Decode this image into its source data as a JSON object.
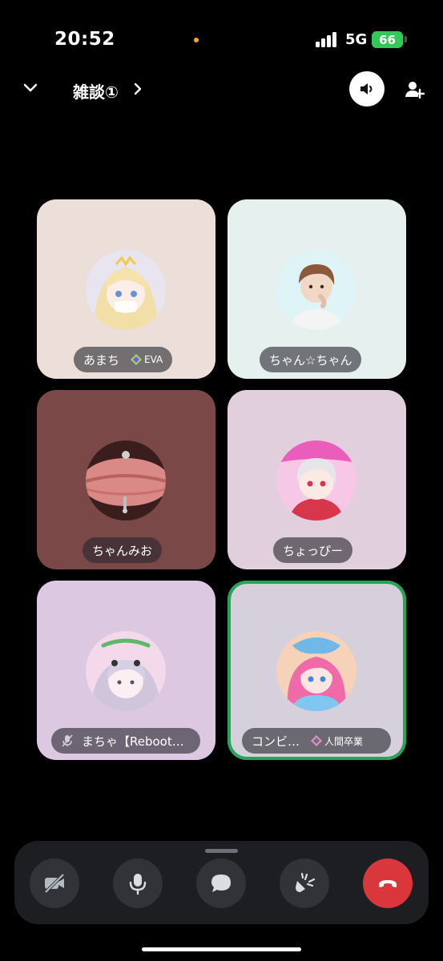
{
  "status_bar": {
    "time": "20:52",
    "network": "5G",
    "battery": "66"
  },
  "header": {
    "channel_title": "雑談①",
    "icons": [
      "chevron-down-icon",
      "chevron-right-icon",
      "speaker-icon",
      "add-user-icon"
    ]
  },
  "participants": [
    {
      "name": "あまち",
      "tag": "EVA",
      "bg": "#ecdfd9",
      "selected": false,
      "muted": false
    },
    {
      "name": "ちゃん☆ちゃん",
      "tag": "",
      "bg": "#e6f0ef",
      "selected": false,
      "muted": false
    },
    {
      "name": "ちゃんみお",
      "tag": "",
      "bg": "#7b4848",
      "selected": false,
      "muted": false
    },
    {
      "name": "ちょっぴー",
      "tag": "",
      "bg": "#e2cfde",
      "selected": false,
      "muted": false
    },
    {
      "name": "まちゃ【Reboot…",
      "tag": "",
      "bg": "#dcc9e1",
      "selected": false,
      "muted": true
    },
    {
      "name": "コンビ…",
      "tag": "人間卒業",
      "bg": "#d6cfdc",
      "selected": true,
      "muted": false
    }
  ],
  "controls": [
    "camera-off-icon",
    "microphone-icon",
    "chat-icon",
    "activity-icon",
    "end-call-icon"
  ],
  "colors": {
    "speaking_border": "#23a55a",
    "end_call": "#da373c",
    "battery": "#34c759"
  }
}
